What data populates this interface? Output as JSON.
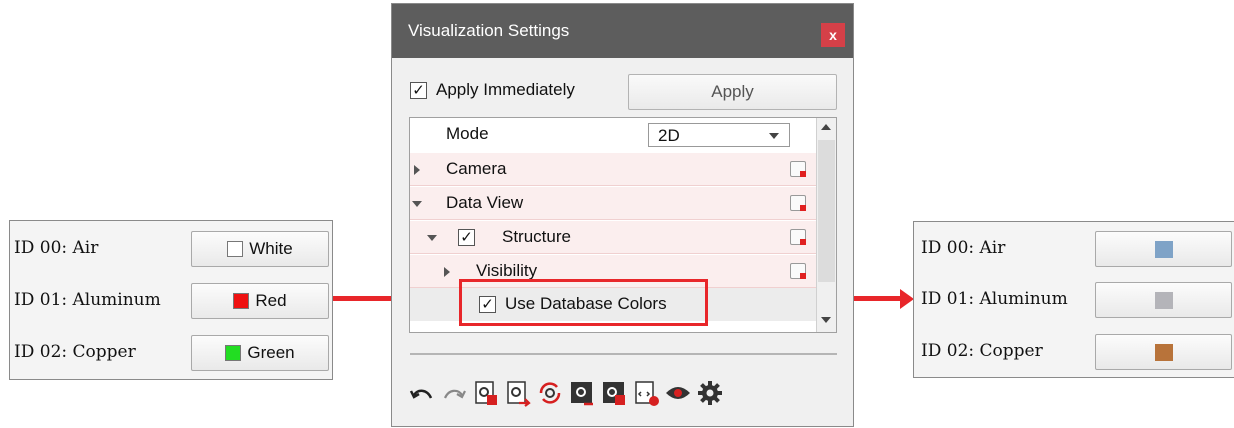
{
  "left_panel": {
    "rows": [
      {
        "label": "ID 00: Air",
        "button": "White",
        "swatch": "#ffffff"
      },
      {
        "label": "ID 01: Aluminum",
        "button": "Red",
        "swatch": "#ee1111"
      },
      {
        "label": "ID 02: Copper",
        "button": "Green",
        "swatch": "#22dd22"
      }
    ]
  },
  "right_panel": {
    "rows": [
      {
        "label": "ID 00: Air",
        "swatch": "#7fa3c7"
      },
      {
        "label": "ID 01: Aluminum",
        "swatch": "#b4b4b9"
      },
      {
        "label": "ID 02: Copper",
        "swatch": "#b8733a"
      }
    ]
  },
  "dialog": {
    "title": "Visualization Settings",
    "close": "x",
    "apply_immediately": {
      "label": "Apply Immediately",
      "checked": true,
      "mark": "✓"
    },
    "apply_button": "Apply",
    "tree": {
      "mode": {
        "label": "Mode",
        "value": "2D"
      },
      "camera": "Camera",
      "data_view": "Data View",
      "structure": {
        "label": "Structure",
        "mark": "✓"
      },
      "visibility": "Visibility",
      "use_db_colors": {
        "label": "Use Database Colors",
        "mark": "✓"
      }
    },
    "toolbar_icons": [
      "undo-icon",
      "redo-icon",
      "settings-save-icon",
      "settings-export-icon",
      "settings-reload-icon",
      "settings-dark-icon",
      "settings-dark-save-icon",
      "settings-code-icon",
      "eye-icon",
      "gear-icon"
    ]
  },
  "colors": {
    "accent": "#e8262a",
    "titlebar": "#5d5d5d",
    "close": "#d54048"
  }
}
